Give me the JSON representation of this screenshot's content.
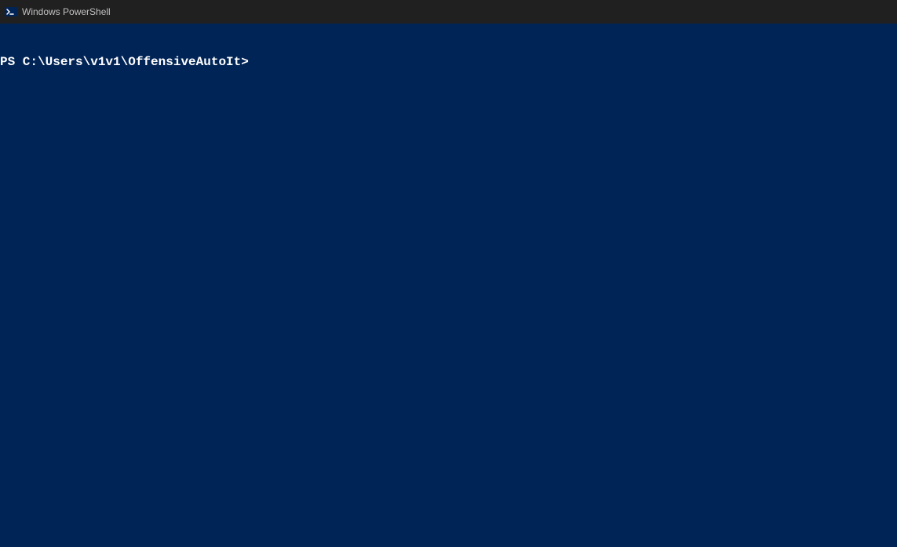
{
  "window": {
    "title": "Windows PowerShell"
  },
  "terminal": {
    "prompt": "PS C:\\Users\\v1v1\\OffensiveAutoIt> ",
    "input": ""
  }
}
